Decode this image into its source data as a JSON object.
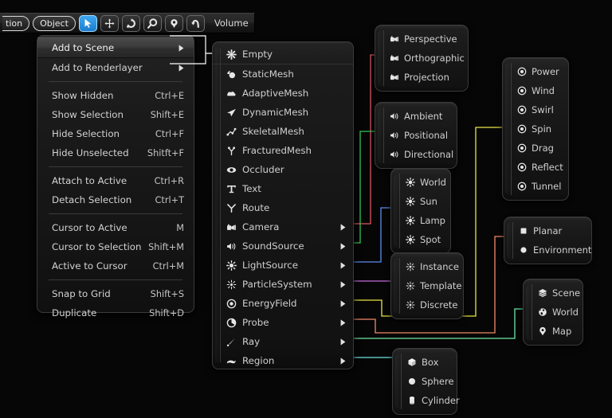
{
  "toolbar": {
    "truncated_label": "tion",
    "object_label": "Object",
    "volume_label": "Volume",
    "icons": [
      "cursor-arrow-icon",
      "move-icon",
      "rotate-icon",
      "zoom-icon",
      "pin-icon",
      "undo-icon"
    ]
  },
  "main_menu": {
    "items": [
      {
        "label": "Add to Scene",
        "accel": "",
        "arrow": true,
        "highlight": true
      },
      {
        "label": "Add to Renderlayer",
        "accel": "",
        "arrow": true,
        "highlight": false
      },
      {
        "separator": true
      },
      {
        "label": "Show Hidden",
        "accel": "Ctrl+E"
      },
      {
        "label": "Show Selection",
        "accel": "Shift+E"
      },
      {
        "label": "Hide Selection",
        "accel": "Ctrl+F"
      },
      {
        "label": "Hide Unselected",
        "accel": "Shitft+F"
      },
      {
        "separator": true
      },
      {
        "label": "Attach to Active",
        "accel": "Ctrl+R"
      },
      {
        "label": "Detach Selection",
        "accel": "Ctrl+T"
      },
      {
        "separator": true
      },
      {
        "label": "Cursor to Active",
        "accel": "M"
      },
      {
        "label": "Cursor to Selection",
        "accel": "Shift+M"
      },
      {
        "label": "Active to Cursor",
        "accel": "Ctrl+M"
      },
      {
        "separator": true
      },
      {
        "label": "Snap to Grid",
        "accel": "Shift+S"
      },
      {
        "label": "Duplicate",
        "accel": "Shift+D"
      }
    ]
  },
  "add_to_scene_submenu": {
    "items": [
      {
        "label": "Empty",
        "icon": "asterisk-icon",
        "arrow": false,
        "first": true
      },
      {
        "label": "StaticMesh",
        "icon": "static-mesh-icon",
        "arrow": false
      },
      {
        "label": "AdaptiveMesh",
        "icon": "cloud-mesh-icon",
        "arrow": false
      },
      {
        "label": "DynamicMesh",
        "icon": "dart-mesh-icon",
        "arrow": false
      },
      {
        "label": "SkeletalMesh",
        "icon": "skeleton-icon",
        "arrow": false
      },
      {
        "label": "FracturedMesh",
        "icon": "fracture-icon",
        "arrow": false
      },
      {
        "label": "Occluder",
        "icon": "eye-icon",
        "arrow": false
      },
      {
        "label": "Text",
        "icon": "text-t-icon",
        "arrow": false
      },
      {
        "label": "Route",
        "icon": "route-y-icon",
        "arrow": false
      },
      {
        "label": "Camera",
        "icon": "camera-icon",
        "arrow": true,
        "wire": "#e05561"
      },
      {
        "label": "SoundSource",
        "icon": "speaker-icon",
        "arrow": true,
        "wire": "#34c759"
      },
      {
        "label": "LightSource",
        "icon": "sun-icon",
        "arrow": true,
        "wire": "#5b8def"
      },
      {
        "label": "ParticleSystem",
        "icon": "particle-icon",
        "arrow": true,
        "wire": "#c36ddc"
      },
      {
        "label": "EnergyField",
        "icon": "target-icon",
        "arrow": true,
        "wire": "#e8e545"
      },
      {
        "label": "Probe",
        "icon": "probe-icon",
        "arrow": true,
        "wire": "#ef8a6a"
      },
      {
        "label": "Ray",
        "icon": "ray-icon",
        "arrow": true,
        "wire": "#6ee8a8"
      },
      {
        "label": "Region",
        "icon": "region-icon",
        "arrow": true,
        "wire": "#6fe4e4"
      }
    ]
  },
  "popups": {
    "camera": {
      "items": [
        {
          "label": "Perspective",
          "icon": "camera-icon"
        },
        {
          "label": "Orthographic",
          "icon": "camera-icon"
        },
        {
          "label": "Projection",
          "icon": "camera-icon"
        }
      ]
    },
    "sound": {
      "items": [
        {
          "label": "Ambient",
          "icon": "speaker-icon"
        },
        {
          "label": "Positional",
          "icon": "speaker-icon"
        },
        {
          "label": "Directional",
          "icon": "speaker-icon"
        }
      ]
    },
    "light": {
      "items": [
        {
          "label": "World",
          "icon": "sun-icon"
        },
        {
          "label": "Sun",
          "icon": "sun-icon"
        },
        {
          "label": "Lamp",
          "icon": "sun-icon"
        },
        {
          "label": "Spot",
          "icon": "sun-icon"
        }
      ]
    },
    "particle": {
      "items": [
        {
          "label": "Instance",
          "icon": "particle-icon"
        },
        {
          "label": "Template",
          "icon": "particle-icon"
        },
        {
          "label": "Discrete",
          "icon": "particle-icon"
        }
      ]
    },
    "energyfield": {
      "items": [
        {
          "label": "Power",
          "icon": "target-icon"
        },
        {
          "label": "Wind",
          "icon": "target-icon"
        },
        {
          "label": "Swirl",
          "icon": "target-icon"
        },
        {
          "label": "Spin",
          "icon": "target-icon"
        },
        {
          "label": "Drag",
          "icon": "target-icon"
        },
        {
          "label": "Reflect",
          "icon": "target-icon"
        },
        {
          "label": "Tunnel",
          "icon": "target-icon"
        }
      ]
    },
    "probe": {
      "items": [
        {
          "label": "Planar",
          "icon": "square-icon"
        },
        {
          "label": "Environment",
          "icon": "circle-icon"
        }
      ]
    },
    "ray": {
      "items": [
        {
          "label": "Scene",
          "icon": "layers-icon"
        },
        {
          "label": "World",
          "icon": "globe-icon"
        },
        {
          "label": "Map",
          "icon": "map-pin-icon"
        }
      ]
    },
    "region": {
      "items": [
        {
          "label": "Box",
          "icon": "cube-icon"
        },
        {
          "label": "Sphere",
          "icon": "sphere-icon"
        },
        {
          "label": "Cylinder",
          "icon": "cylinder-icon"
        }
      ]
    }
  },
  "colors": {
    "wire_camera": "#e05561",
    "wire_sound": "#34c759",
    "wire_light": "#5b8def",
    "wire_particle": "#c36ddc",
    "wire_energyfield": "#e8e545",
    "wire_probe": "#ef8a6a",
    "wire_ray": "#6ee8a8",
    "wire_region": "#6fe4e4",
    "wire_white": "#ffffff",
    "accent_selected": "#2f8fe0",
    "panel_bg": "#1a1a1a",
    "text": "#cfcfcf"
  }
}
